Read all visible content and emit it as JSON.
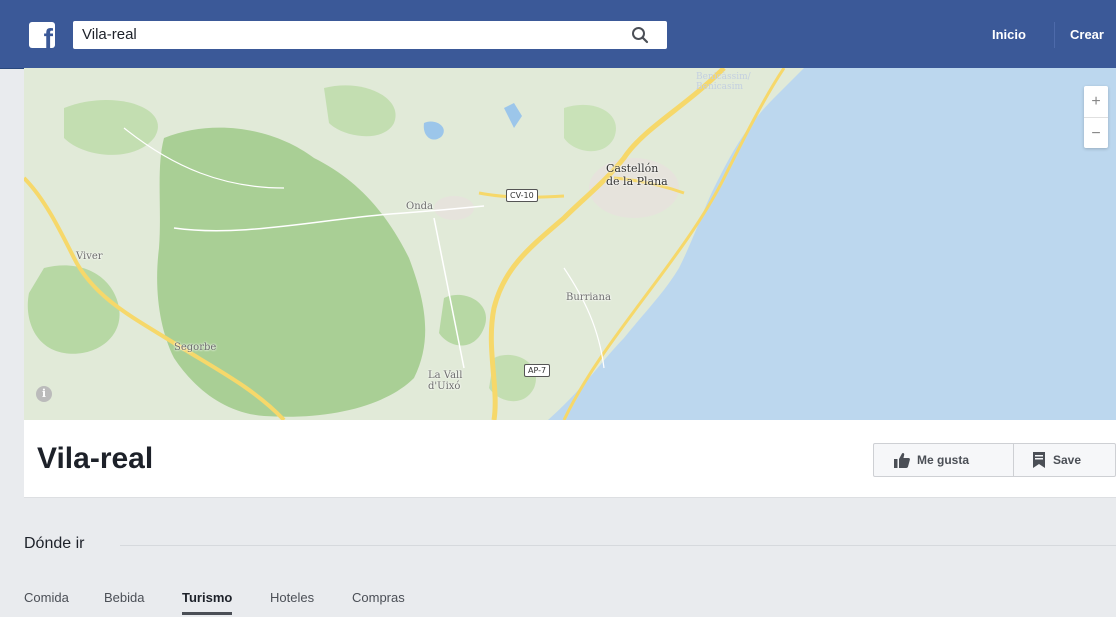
{
  "topbar": {
    "logo_letter": "f",
    "search_value": "Vila-real",
    "nav_links": [
      "Inicio",
      "Crear"
    ]
  },
  "map": {
    "labels": {
      "benicassim": "Benicàssim/\nBenicasim",
      "castellon": "Castellón\nde la Plana",
      "onda": "Onda",
      "viver": "Viver",
      "burriana": "Burriana",
      "segorbe": "Segorbe",
      "lavall": "La Vall\nd'Uixó"
    },
    "road_shields": {
      "cv10": "CV-10",
      "ap7": "AP-7"
    },
    "zoom_in": "+",
    "zoom_out": "−",
    "info": "i"
  },
  "page": {
    "title": "Vila-real",
    "like_label": "Me gusta",
    "save_label": "Save"
  },
  "where_to_go": {
    "heading": "Dónde ir",
    "tabs": [
      "Comida",
      "Bebida",
      "Turismo",
      "Hoteles",
      "Compras"
    ],
    "active_tab": "Turismo"
  },
  "colors": {
    "brand_blue": "#3b5998",
    "sea": "#bcd7ee",
    "land": "#dfe9d6",
    "forest": "#a9cf95",
    "highway": "#f6d86a"
  }
}
